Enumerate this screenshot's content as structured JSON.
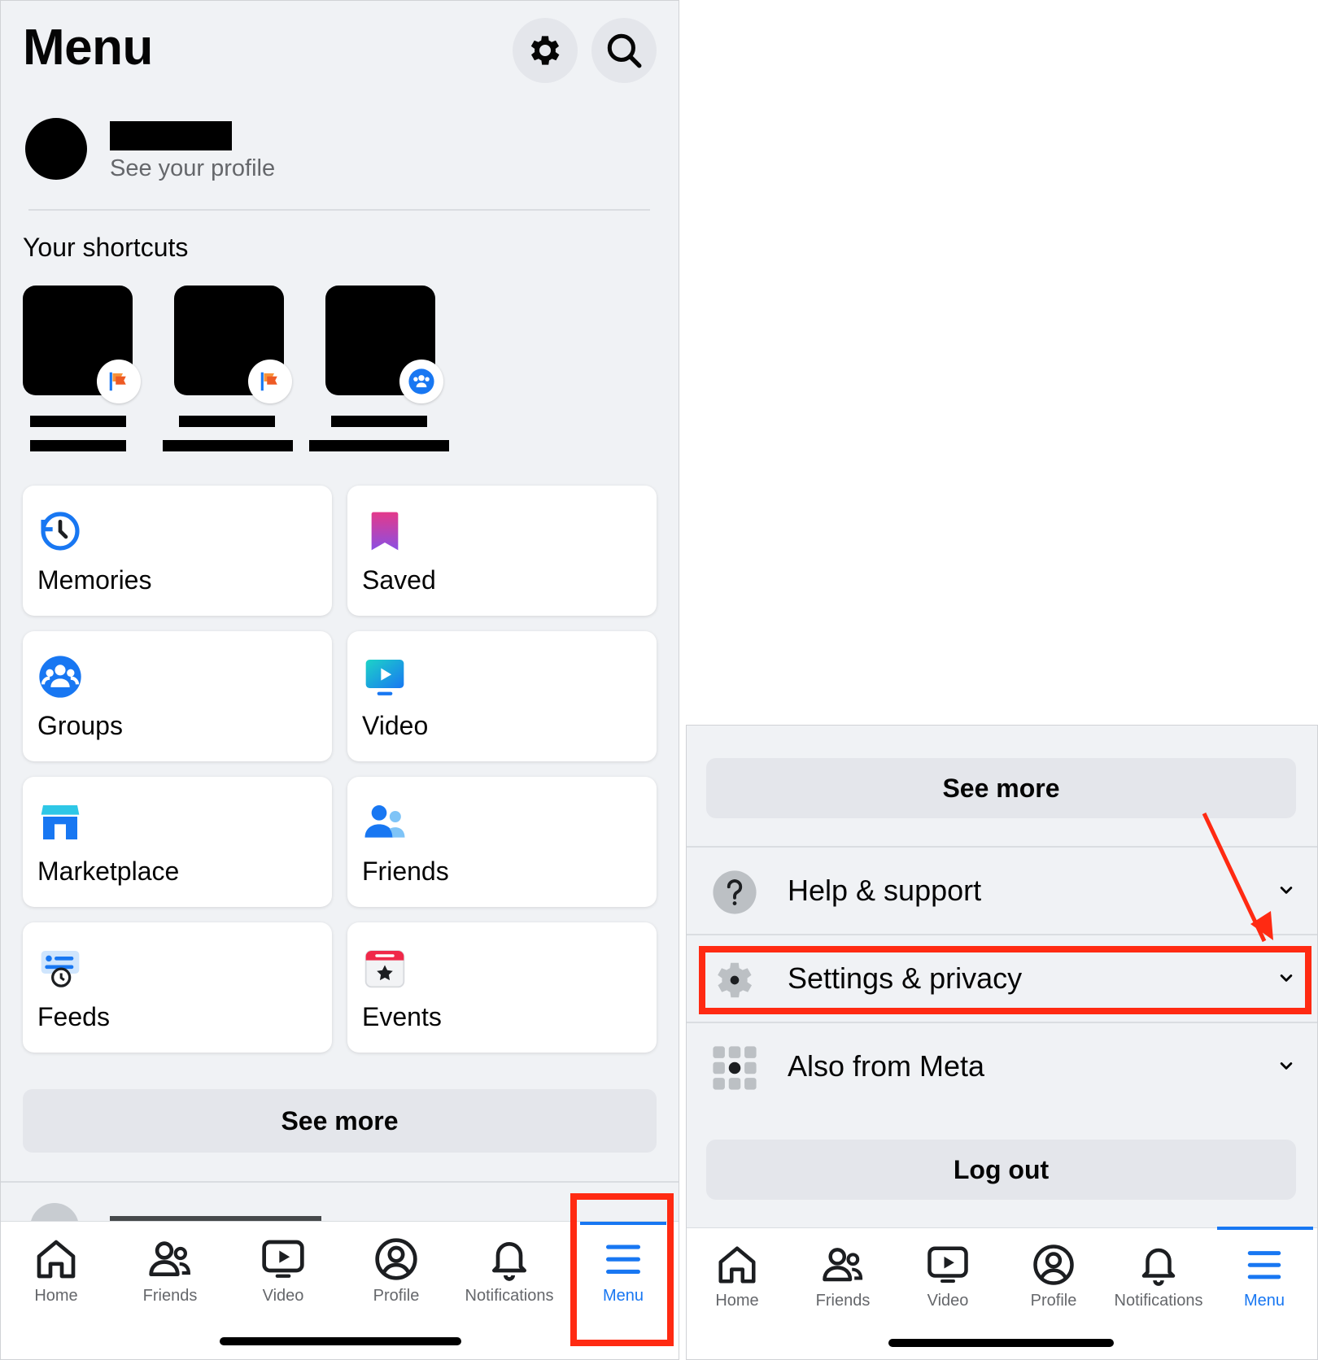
{
  "left_panel": {
    "title": "Menu",
    "profile": {
      "subtitle": "See your profile"
    },
    "shortcuts_heading": "Your shortcuts",
    "tiles": [
      {
        "label": "Memories",
        "icon": "memories-icon"
      },
      {
        "label": "Saved",
        "icon": "saved-icon"
      },
      {
        "label": "Groups",
        "icon": "groups-icon"
      },
      {
        "label": "Video",
        "icon": "video-icon"
      },
      {
        "label": "Marketplace",
        "icon": "marketplace-icon"
      },
      {
        "label": "Friends",
        "icon": "friends-icon"
      },
      {
        "label": "Feeds",
        "icon": "feeds-icon"
      },
      {
        "label": "Events",
        "icon": "events-icon"
      }
    ],
    "see_more": "See more"
  },
  "right_panel": {
    "see_more": "See more",
    "rows": [
      {
        "label": "Help & support",
        "icon": "help-icon"
      },
      {
        "label": "Settings & privacy",
        "icon": "gear-icon"
      },
      {
        "label": "Also from Meta",
        "icon": "apps-grid-icon"
      }
    ],
    "logout": "Log out"
  },
  "tabbar": {
    "tabs": [
      {
        "label": "Home",
        "icon": "home-icon"
      },
      {
        "label": "Friends",
        "icon": "friends-icon"
      },
      {
        "label": "Video",
        "icon": "video-icon"
      },
      {
        "label": "Profile",
        "icon": "profile-icon"
      },
      {
        "label": "Notifications",
        "icon": "bell-icon"
      },
      {
        "label": "Menu",
        "icon": "hamburger-icon"
      }
    ],
    "active": "Menu"
  },
  "colors": {
    "accent": "#1877f2",
    "annotation": "#ff2a12",
    "background": "#f0f2f5",
    "button_gray": "#e4e6eb"
  }
}
